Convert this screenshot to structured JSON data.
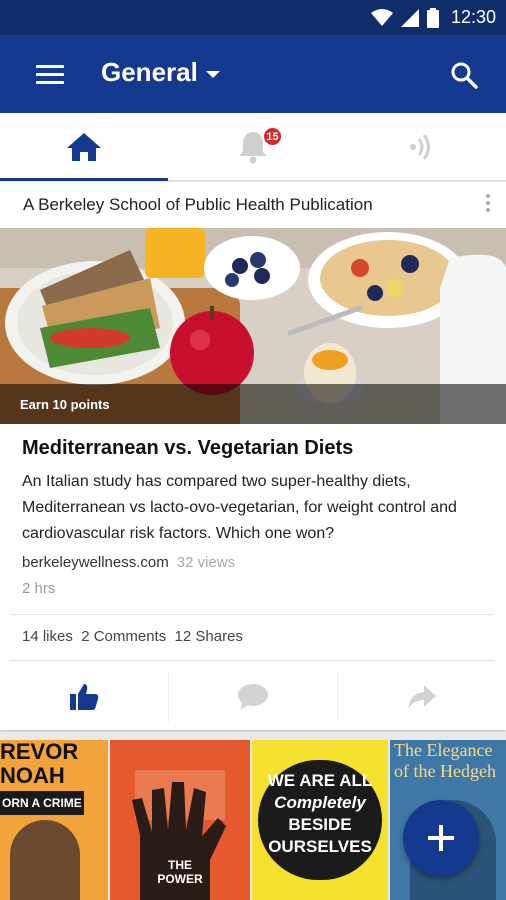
{
  "status_bar": {
    "time": "12:30"
  },
  "app_bar": {
    "title": "General"
  },
  "tabs": {
    "notification_count": "15"
  },
  "card": {
    "publisher": "A Berkeley School of Public Health Publication",
    "points_label": "Earn 10 points",
    "headline": "Mediterranean vs. Vegetarian Diets",
    "summary": "An Italian study has compared two super-healthy diets, Mediterranean vs lacto-ovo-vegetarian, for weight control and cardiovascular risk factors. Which one won?",
    "source": "berkeleywellness.com",
    "views": "32 views",
    "age": "2 hrs",
    "stats": "14 likes  2 Comments  12 Shares"
  },
  "books": [
    {
      "line1": "REVOR",
      "line2": "NOAH",
      "line3": "ORN A CRIME"
    },
    {
      "line1": "THE",
      "line2": "POWER"
    },
    {
      "line1": "WE ARE ALL",
      "line2": "Completely",
      "line3": "BESIDE",
      "line4": "OURSELVES"
    },
    {
      "line1": "The Elegance",
      "line2": "of the Hedgeh"
    }
  ],
  "colors": {
    "primary": "#14398e",
    "status_bar": "#0f2d6b",
    "badge": "#d9262b"
  }
}
